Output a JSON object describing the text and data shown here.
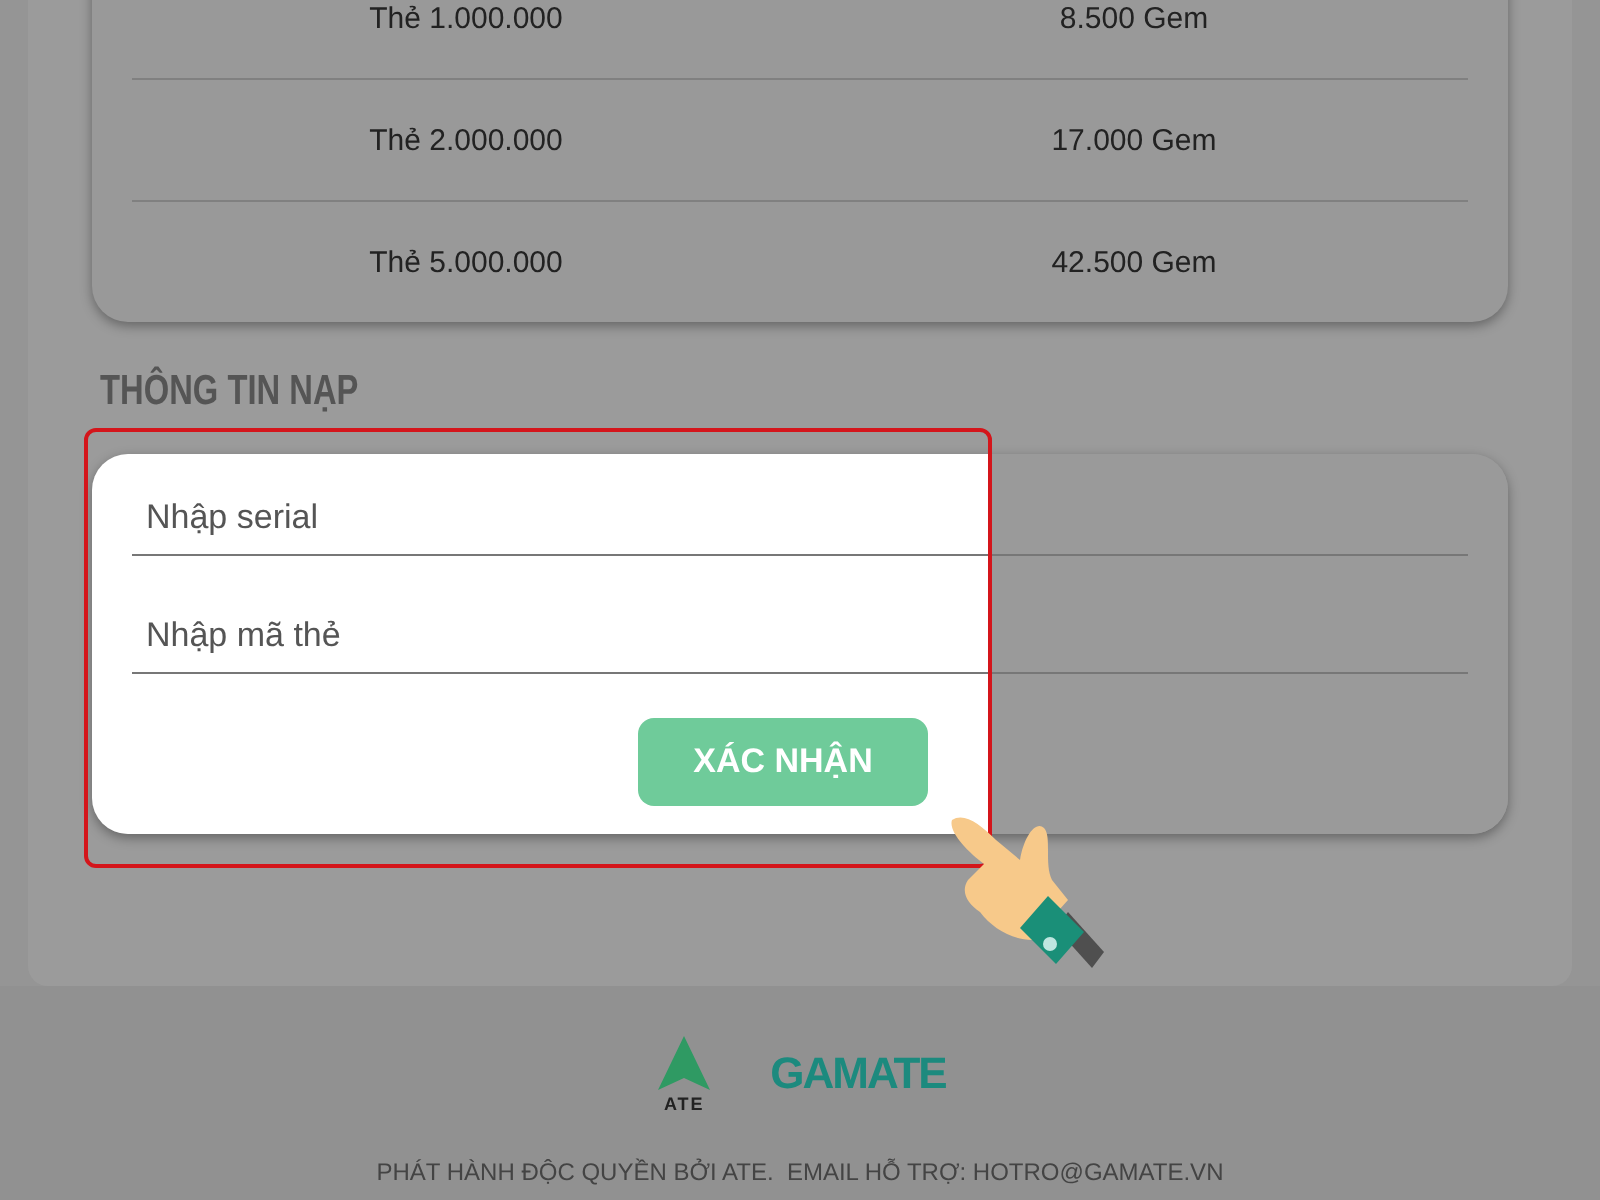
{
  "rate_table": {
    "rows": [
      {
        "card": "Thẻ 1.000.000",
        "gem": "8.500 Gem"
      },
      {
        "card": "Thẻ 2.000.000",
        "gem": "17.000 Gem"
      },
      {
        "card": "Thẻ 5.000.000",
        "gem": "42.500 Gem"
      }
    ]
  },
  "topup_section": {
    "heading": "THÔNG TIN NẠP",
    "fields": [
      {
        "placeholder": "Nhập serial"
      },
      {
        "placeholder": "Nhập mã thẻ"
      }
    ],
    "submit_button": "XÁC NHẬN"
  },
  "footer": {
    "logos": [
      {
        "kind": "triangle",
        "label": "ATE"
      },
      {
        "kind": "wordmark",
        "label": "GAMATE"
      }
    ],
    "text": "PHÁT HÀNH ĐỘC QUYỀN BỞI ATE.  EMAIL HỖ TRỢ: HOTRO@GAMATE.VN"
  }
}
